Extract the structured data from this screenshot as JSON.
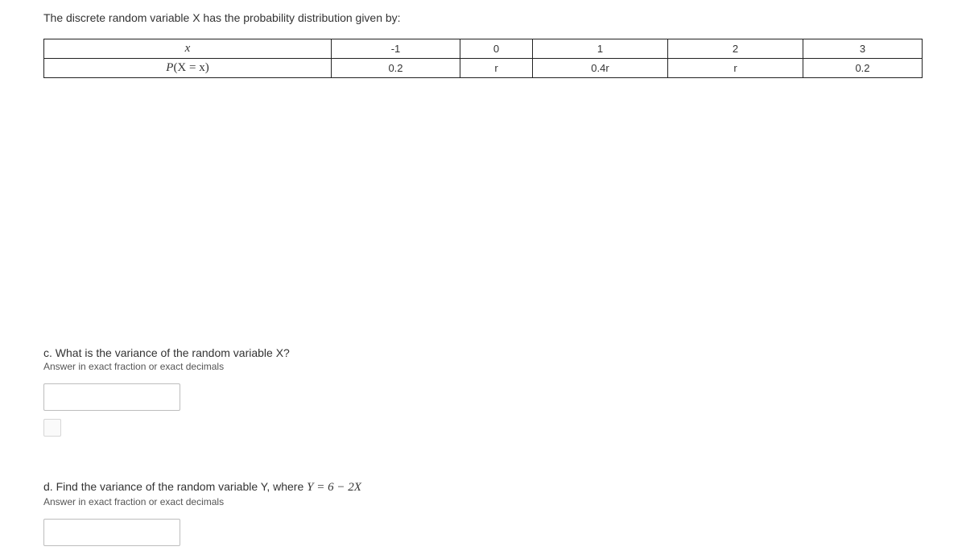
{
  "prompt": "The discrete random variable X has the probability distribution given by:",
  "table": {
    "row1": {
      "label_math": "x",
      "c1": "-1",
      "c2": "0",
      "c3": "1",
      "c4": "2",
      "c5": "3"
    },
    "row2": {
      "label_prefix": "P",
      "label_mid": "(X = x)",
      "c1": "0.2",
      "c2": "r",
      "c3": "0.4r",
      "c4": "r",
      "c5": "0.2"
    }
  },
  "questions": {
    "c": {
      "label": "c. What is the variance of the random variable X?",
      "hint": "Answer in exact fraction or exact decimals",
      "value": ""
    },
    "d": {
      "label_prefix": "d. Find the variance of the random variable Y, where ",
      "label_math": "Y = 6 − 2X",
      "hint": "Answer in exact fraction or exact decimals",
      "value": ""
    }
  }
}
